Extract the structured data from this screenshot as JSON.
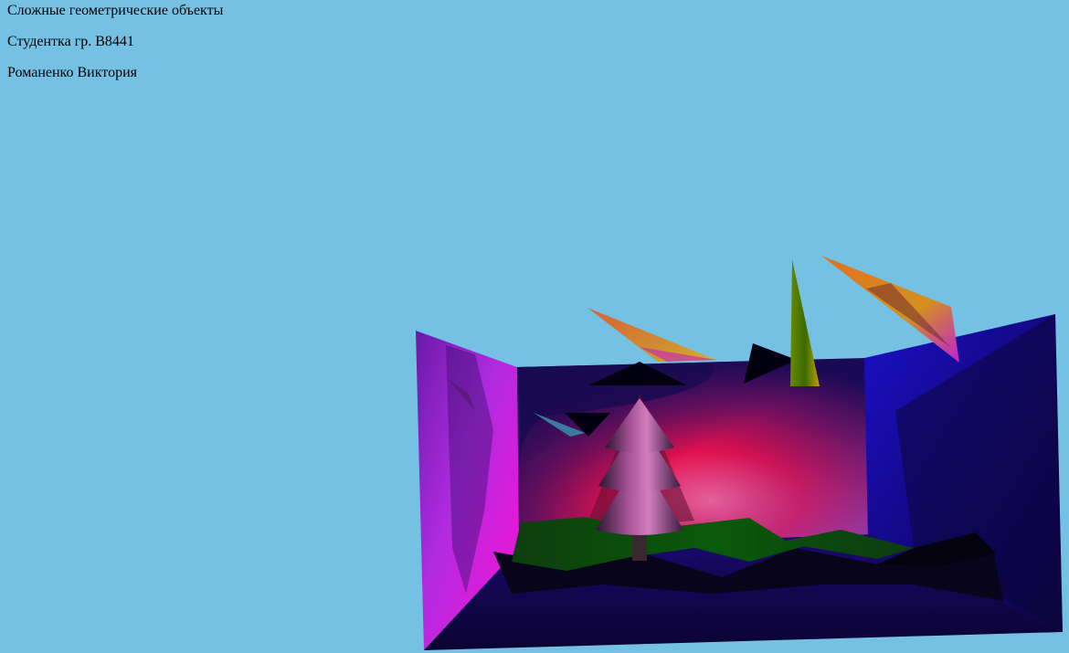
{
  "page": {
    "background": "#75c1e4",
    "title": "Сложные геометрические объекты",
    "student_group": "Студентка гр. В8441",
    "student_name": "Романенко Виктория"
  },
  "scene": {
    "objects": [
      "room-box",
      "christmas-tree",
      "ground-terrain",
      "floating-cones"
    ]
  }
}
